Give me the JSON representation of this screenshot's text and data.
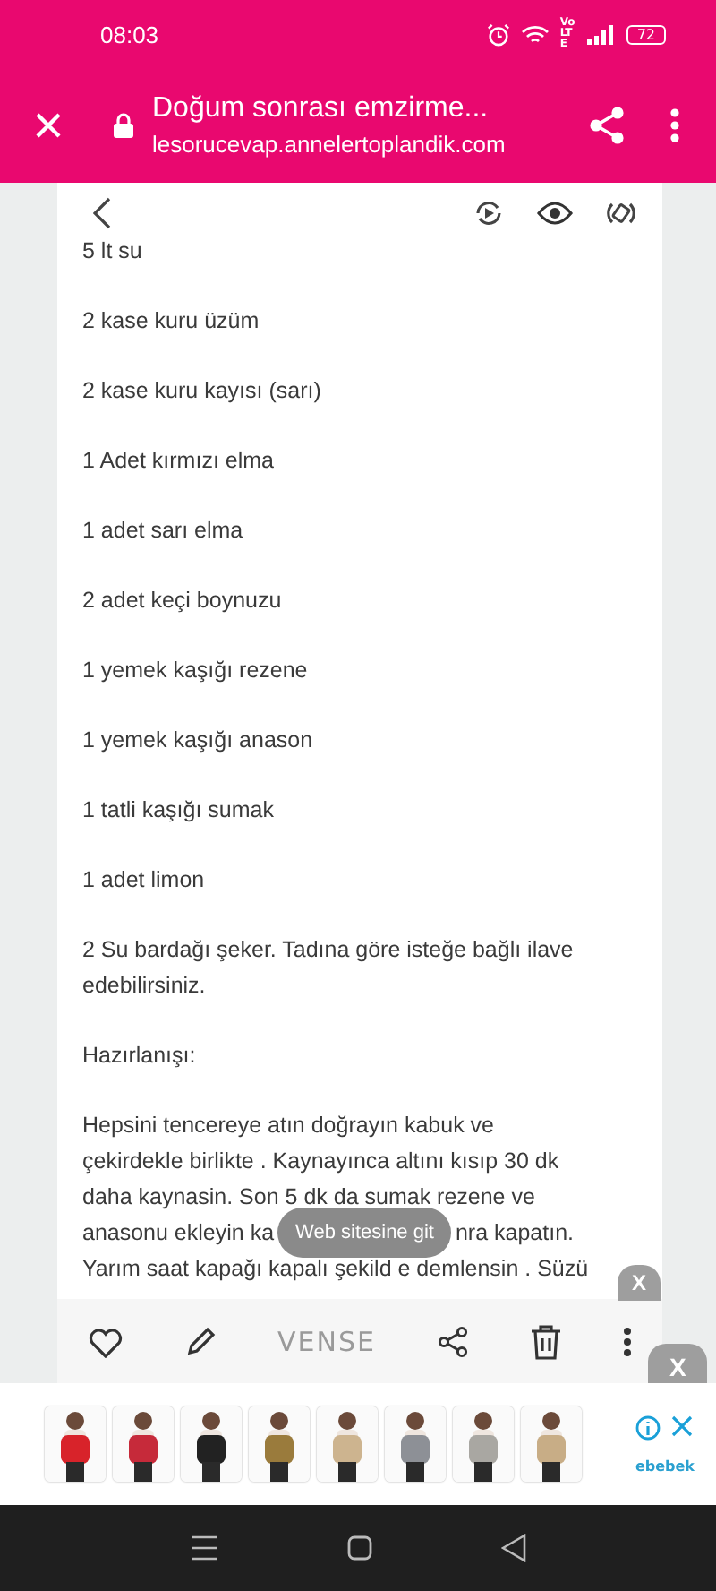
{
  "status_bar": {
    "time": "08:03",
    "network": "Vo LTE",
    "battery": "72"
  },
  "toolbar": {
    "title": "Doğum sonrası emzirme...",
    "url": "lesorucevap.annelertoplandik.com"
  },
  "note": {
    "lines": [
      {
        "kind": "line",
        "text": "5 lt su"
      },
      {
        "kind": "line",
        "text": "2  kase kuru üzüm"
      },
      {
        "kind": "line",
        "text": "2  kase kuru kayısı (sarı)"
      },
      {
        "kind": "line",
        "text": "1 Adet kırmızı elma"
      },
      {
        "kind": "line",
        "text": "1 adet sarı elma"
      },
      {
        "kind": "line",
        "text": "2 adet keçi boynuzu"
      },
      {
        "kind": "line",
        "text": "1 yemek kaşığı rezene"
      },
      {
        "kind": "line",
        "text": "1 yemek kaşığı anason"
      },
      {
        "kind": "line",
        "text": "1 tatli kaşığı sumak"
      },
      {
        "kind": "line",
        "text": "1 adet limon"
      },
      {
        "kind": "line",
        "text": "2 Su bardağı şeker.  Tadına göre isteğe bağlı ilave edebilirsiniz."
      },
      {
        "kind": "line",
        "text": "Hazırlanışı:"
      },
      {
        "kind": "para",
        "lines": [
          {
            "kind": "text",
            "text": "Hepsini tencereye atın doğrayın kabuk ve"
          },
          {
            "kind": "text",
            "text": "çekirdekle birlikte . Kaynayınca altını kısıp 30 dk"
          },
          {
            "kind": "text",
            "text": "daha kaynasin. Son 5 dk da sumak rezene ve"
          },
          {
            "kind": "covered",
            "before": "anasonu ekleyin ka",
            "after": "nra kapatın."
          },
          {
            "kind": "text",
            "text": "Yarım saat kapağı kapalı şekild e demlensin . Süzü"
          }
        ]
      }
    ]
  },
  "toast": "Web sitesine git",
  "ad_close_buttons": [
    "X",
    "X"
  ],
  "inline_ad": {
    "brand": "VENSE"
  },
  "banner_ad": {
    "brand": "ebebek"
  }
}
